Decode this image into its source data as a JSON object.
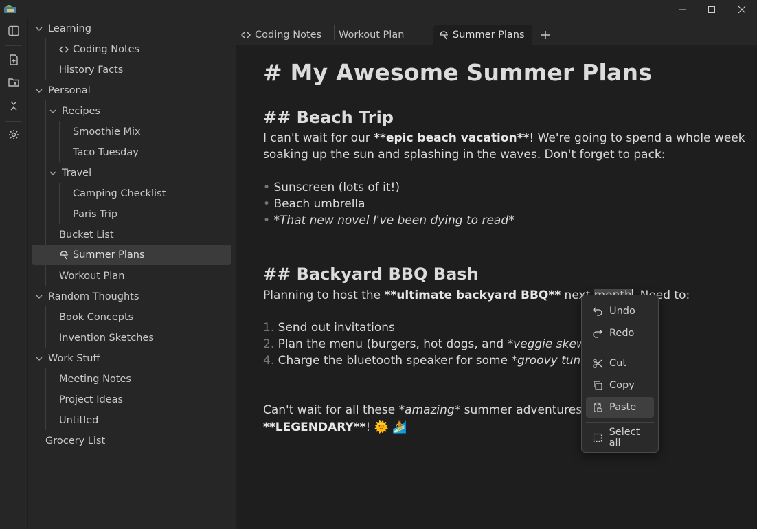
{
  "window": {
    "minimize_icon": "minimize-icon",
    "maximize_icon": "maximize-icon",
    "close_icon": "close-icon"
  },
  "ribbon": {
    "icons": [
      "sidebar-toggle-icon",
      "new-note-icon",
      "new-folder-icon",
      "collapse-all-icon",
      "settings-icon"
    ]
  },
  "sidebar": {
    "items": [
      {
        "label": "Learning"
      },
      {
        "label": "Coding Notes"
      },
      {
        "label": "History Facts"
      },
      {
        "label": "Personal"
      },
      {
        "label": "Recipes"
      },
      {
        "label": "Smoothie Mix"
      },
      {
        "label": "Taco Tuesday"
      },
      {
        "label": "Travel"
      },
      {
        "label": "Camping Checklist"
      },
      {
        "label": "Paris Trip"
      },
      {
        "label": "Bucket List"
      },
      {
        "label": "Summer Plans"
      },
      {
        "label": "Workout Plan"
      },
      {
        "label": "Random Thoughts"
      },
      {
        "label": "Book Concepts"
      },
      {
        "label": "Invention Sketches"
      },
      {
        "label": "Work Stuff"
      },
      {
        "label": "Meeting Notes"
      },
      {
        "label": "Project Ideas"
      },
      {
        "label": "Untitled"
      },
      {
        "label": "Grocery List"
      }
    ]
  },
  "tabs": [
    {
      "label": "Coding Notes"
    },
    {
      "label": "Workout Plan"
    },
    {
      "label": "Summer Plans"
    }
  ],
  "editor": {
    "h1": "# My Awesome Summer Plans",
    "h2_beach": "## Beach Trip",
    "p1_a": "I can't wait for our ",
    "p1_b": "**epic beach vacation**",
    "p1_c": "! We're going to spend a whole week",
    "p1_line2": "soaking up the sun and splashing in the waves. Don't forget to pack:",
    "bullet": "•",
    "list1": [
      "Sunscreen (lots of it!)",
      "Beach umbrella",
      "*That new novel I've been dying to read*"
    ],
    "h2_bbq": "## Backyard BBQ Bash",
    "p2_a": "Planning to host the ",
    "p2_b": "**ultimate backyard BBQ**",
    "p2_c": " next ",
    "p2_sel": "month",
    "p2_d": ". Need to:",
    "ol_nums": [
      "1.",
      "2.",
      "4."
    ],
    "ol1": "Send out invitations",
    "ol2_a": "Plan the menu (burgers, hot dogs, and ",
    "ol2_b": "*veggie skewers*",
    "ol2_c": ")",
    "ol3_a": "Charge the bluetooth speaker for some ",
    "ol3_b": "*groovy tunes*",
    "p3_a": "Can't wait for all these ",
    "p3_b": "*amazing*",
    "p3_c": " summer adventures! It's ",
    "p4_a": "**LEGENDARY**",
    "p4_b": "! 🌞 🏄"
  },
  "context_menu": {
    "items": [
      {
        "label": "Undo",
        "icon": "undo-icon"
      },
      {
        "label": "Redo",
        "icon": "redo-icon"
      },
      {
        "label": "Cut",
        "icon": "scissors-icon"
      },
      {
        "label": "Copy",
        "icon": "copy-icon"
      },
      {
        "label": "Paste",
        "icon": "paste-icon"
      },
      {
        "label": "Select all",
        "icon": "select-all-icon"
      }
    ]
  }
}
